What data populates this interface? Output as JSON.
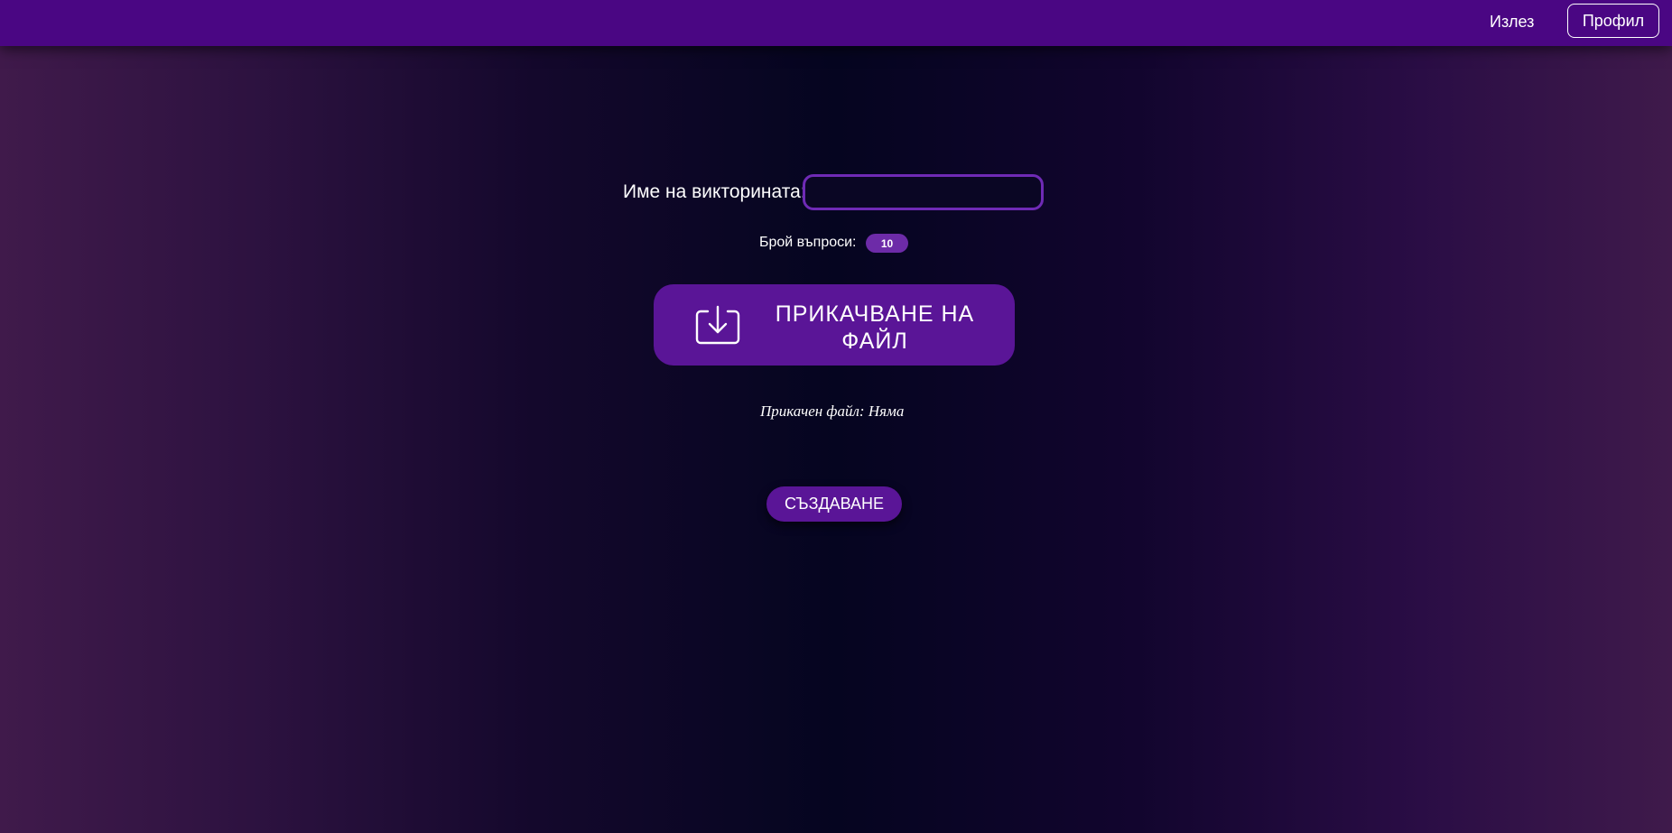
{
  "header": {
    "logout_label": "Излез",
    "profile_label": "Профил",
    "bar_color": "#4a0683"
  },
  "form": {
    "name_label": "Име на викторината:",
    "name_value": "",
    "questions_label": "Брой въпроси:",
    "questions_count": "10",
    "upload_label": "ПРИКАЧВАНЕ НА ФАЙЛ",
    "upload_icon": "download-tray-icon",
    "attached_text": "Прикачен файл: Няма",
    "create_label": "СЪЗДАВАНЕ"
  },
  "colors": {
    "accent": "#5a1597",
    "input_border": "#6f2ab5"
  }
}
